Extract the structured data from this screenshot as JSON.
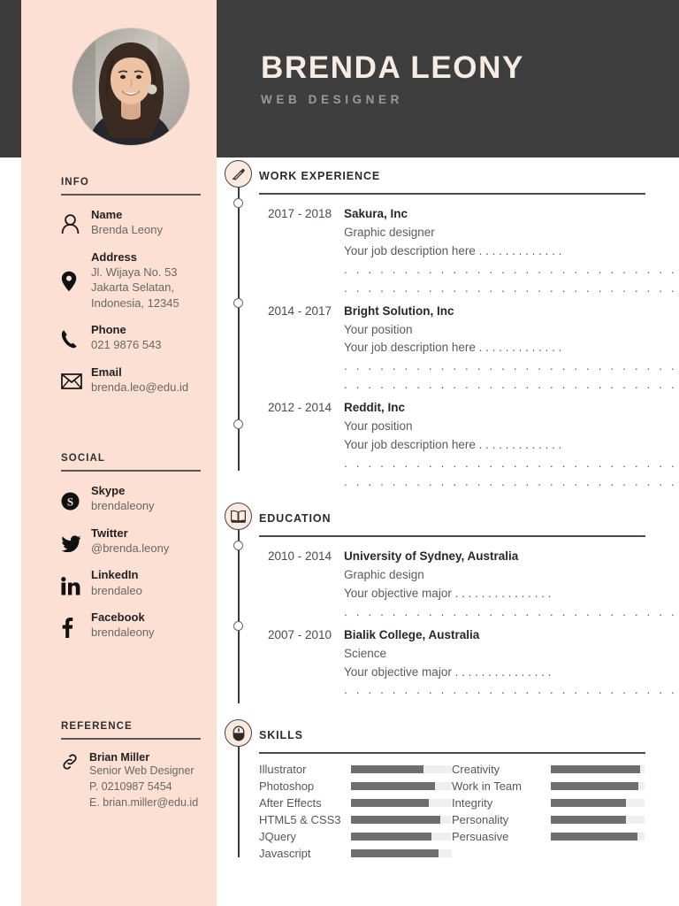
{
  "header": {
    "name": "BRENDA LEONY",
    "role": "WEB DESIGNER"
  },
  "colors": {
    "sidebar_bg": "#fbe0d3",
    "header_bg": "#3f3e3e",
    "name_text": "#f7ece4",
    "role_text": "#9b9896",
    "rule": "#5c5654",
    "bar_fill": "#6e6e6e",
    "bar_track": "#efefef",
    "badge_bg": "#faeadf",
    "badge_border": "#49433f"
  },
  "sidebar": {
    "info": {
      "title": "INFO",
      "entries": [
        {
          "icon": "person-icon",
          "label": "Name",
          "values": [
            "Brenda Leony"
          ]
        },
        {
          "icon": "location-pin-icon",
          "label": "Address",
          "values": [
            "Jl. Wijaya No. 53",
            "Jakarta Selatan,",
            "Indonesia, 12345"
          ]
        },
        {
          "icon": "phone-icon",
          "label": "Phone",
          "values": [
            "021 9876 543"
          ]
        },
        {
          "icon": "envelope-icon",
          "label": "Email",
          "values": [
            "brenda.leo@edu.id"
          ]
        }
      ]
    },
    "social": {
      "title": "SOCIAL",
      "entries": [
        {
          "icon": "skype-icon",
          "label": "Skype",
          "values": [
            "brendaleony"
          ]
        },
        {
          "icon": "twitter-icon",
          "label": "Twitter",
          "values": [
            "@brenda.leony"
          ]
        },
        {
          "icon": "linkedin-icon",
          "label": "LinkedIn",
          "values": [
            "brendaleo"
          ]
        },
        {
          "icon": "facebook-icon",
          "label": "Facebook",
          "values": [
            "brendaleony"
          ]
        }
      ]
    },
    "reference": {
      "title": "REFERENCE",
      "icon": "link-icon",
      "name": "Brian Miller",
      "lines": [
        "Senior Web Designer",
        "P. 0210987 5454",
        "E. brian.miller@edu.id"
      ]
    }
  },
  "main": {
    "work": {
      "title": "WORK EXPERIENCE",
      "icon": "pen-icon",
      "items": [
        {
          "years": "2017 - 2018",
          "org_bold": "Sakura",
          "org_rest": ", Inc",
          "position": "Graphic designer",
          "description": "Your job description here . . . . . . . . . . . . .",
          "filler_lines": [
            ". . . . . . . . . . . . . . . . . . . . . . . . . . . . . . .",
            ". . . . . . . . . . . . . . . . . . . . . . . . . . . . . . ."
          ]
        },
        {
          "years": "2014 - 2017",
          "org_bold": "Bright Solution",
          "org_rest": ", Inc",
          "position": "Your position",
          "description": "Your job description here . . . . . . . . . . . . .",
          "filler_lines": [
            ". . . . . . . . . . . . . . . . . . . . . . . . . . . . . . .",
            ". . . . . . . . . . . . . . . . . . . . . . . . . . . . . . ."
          ]
        },
        {
          "years": "2012 - 2014",
          "org_bold": "Reddit",
          "org_rest": ", Inc",
          "position": "Your position",
          "description": "Your job description here . . . . . . . . . . . . .",
          "filler_lines": [
            ". . . . . . . . . . . . . . . . . . . . . . . . . . . . . . .",
            ". . . . . . . . . . . . . . . . . . . . . . . . . . . . . . ."
          ]
        }
      ]
    },
    "education": {
      "title": "EDUCATION",
      "icon": "book-icon",
      "items": [
        {
          "years": "2010 - 2014",
          "org_bold": "University of Sydney",
          "org_rest": ", Australia",
          "position": "Graphic design",
          "description": "Your objective major . . . . . . . . . . . . . . .",
          "filler_lines": [
            ". . . . . . . . . . . . . . . . . . . . . . . . . . . . . . ."
          ]
        },
        {
          "years": "2007 - 2010",
          "org_bold": "Bialik College",
          "org_rest": ", Australia",
          "position": "Science",
          "description": "Your objective major . . . . . . . . . . . . . . .",
          "filler_lines": [
            ". . . . . . . . . . . . . . . . . . . . . . . . . . . . . . ."
          ]
        }
      ]
    },
    "skills": {
      "title": "SKILLS",
      "icon": "mouse-icon",
      "left": [
        {
          "name": "Illustrator",
          "value": 72
        },
        {
          "name": "Photoshop",
          "value": 83
        },
        {
          "name": "After Effects",
          "value": 77
        },
        {
          "name": "HTML5 & CSS3",
          "value": 89
        },
        {
          "name": "JQuery",
          "value": 80
        },
        {
          "name": "Javascript",
          "value": 87
        }
      ],
      "right": [
        {
          "name": "Creativity",
          "value": 95
        },
        {
          "name": "Work in Team",
          "value": 93
        },
        {
          "name": "Integrity",
          "value": 80
        },
        {
          "name": "Personality",
          "value": 80
        },
        {
          "name": "Persuasive",
          "value": 92
        }
      ]
    }
  }
}
